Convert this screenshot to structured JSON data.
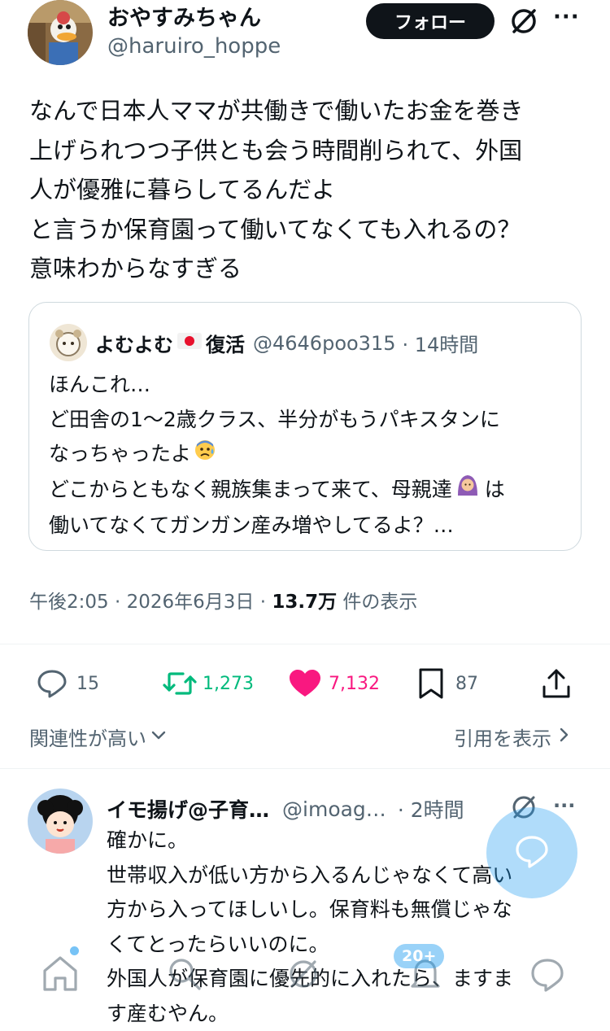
{
  "post": {
    "author_name": "おやすみちゃん",
    "author_handle": "@haruiro_hoppe",
    "follow_label": "フォロー",
    "more_label": "···",
    "text_lines": [
      "なんで日本人ママが共働きで働いたお金を巻き",
      "上げられつつ子供とも会う時間削られて、外国",
      "人が優雅に暮らしてるんだよ",
      "と言うか保育園って働いてなくても入れるの？",
      "意味わからなすぎる"
    ]
  },
  "quote": {
    "author_name": "よむよむ",
    "author_suffix": "復活",
    "author_handle": "@4646poo315",
    "time": "· 14時間",
    "text_lines": [
      "ほんこれ…",
      "ど田舎の1〜2歳クラス、半分がもうパキスタンに",
      "なっちゃったよ",
      "どこからともなく親族集まって来て、母親達",
      "は",
      "働いてなくてガンガン産み増やしてるよ？…"
    ]
  },
  "meta": {
    "time": "午後2:05",
    "sep1": "·",
    "date": "2026年6月3日",
    "sep2": "·",
    "views": "13.7万",
    "views_label": "件の表示"
  },
  "actions": {
    "replies": "15",
    "retweets": "1,273",
    "likes": "7,132",
    "bookmarks": "87"
  },
  "sort": {
    "label": "関連性が高い",
    "quotes_label": "引用を表示"
  },
  "reply": {
    "author_name": "イモ揚げ@子育…",
    "author_handle": "@imoag…",
    "time": "· 2時間",
    "more_label": "···",
    "text_lines": [
      "確かに。",
      "世帯収入が低い方から入るんじゃなくて高い",
      "方から入ってほしいし。保育料も無償じゃな",
      "くてとったらいいのに。",
      "外国人が保育園に優先的に入れたら、ますま",
      "す産むやん。"
    ]
  },
  "tabbar": {
    "notification_badge": "20+"
  },
  "colors": {
    "retweet": "#00ba7c",
    "like": "#f91880",
    "muted": "#536471",
    "accent": "#1d9bf0"
  }
}
